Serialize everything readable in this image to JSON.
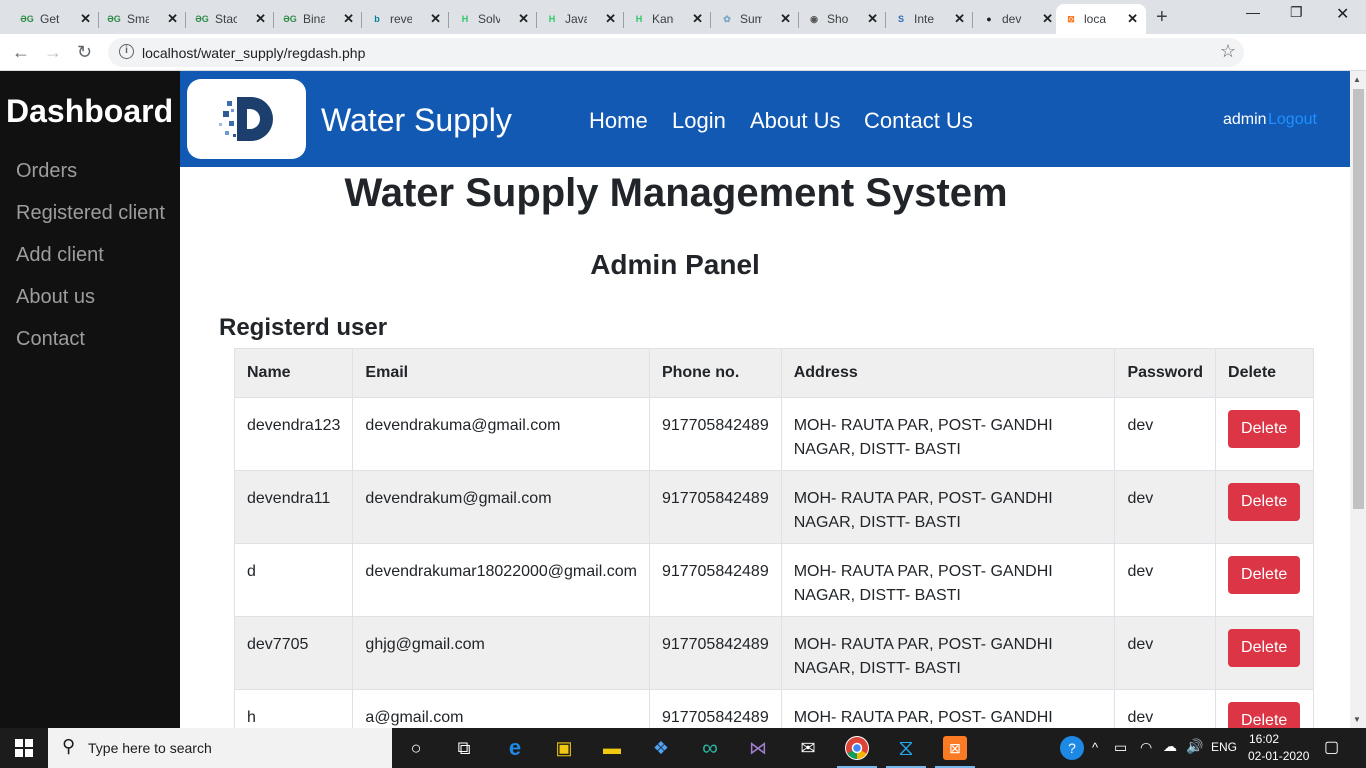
{
  "browser": {
    "tabs": [
      {
        "label": "Get",
        "icon": "geeksforgeeks-icon",
        "fav": "ƏG",
        "color": "#2f8d46"
      },
      {
        "label": "Sma",
        "icon": "geeksforgeeks-icon",
        "fav": "ƏG",
        "color": "#2f8d46"
      },
      {
        "label": "Stac",
        "icon": "geeksforgeeks-icon",
        "fav": "ƏG",
        "color": "#2f8d46"
      },
      {
        "label": "Bina",
        "icon": "geeksforgeeks-icon",
        "fav": "ƏG",
        "color": "#2f8d46"
      },
      {
        "label": "reve",
        "icon": "bing-icon",
        "fav": "b",
        "color": "#00809d"
      },
      {
        "label": "Solv",
        "icon": "hackerrank-icon",
        "fav": "H",
        "color": "#2ec866"
      },
      {
        "label": "Java",
        "icon": "hackerrank-icon",
        "fav": "H",
        "color": "#2ec866"
      },
      {
        "label": "Kang",
        "icon": "hackerrank-icon",
        "fav": "H",
        "color": "#2ec866"
      },
      {
        "label": "Sum",
        "icon": "tree-icon",
        "fav": "✿",
        "color": "#7aa7c7"
      },
      {
        "label": "Shor",
        "icon": "globe-icon",
        "fav": "◉",
        "color": "#555555"
      },
      {
        "label": "Inte",
        "icon": "interviewbit-icon",
        "fav": "S",
        "color": "#2a6ebb"
      },
      {
        "label": "dev",
        "icon": "github-icon",
        "fav": "●",
        "color": "#202124"
      },
      {
        "label": "loca",
        "icon": "xampp-icon",
        "fav": "⊠",
        "color": "#fb7a24"
      }
    ],
    "url": "localhost/water_supply/regdash.php"
  },
  "sidebar": {
    "brand": "Dashboard",
    "items": [
      "Orders",
      "Registered client",
      "Add client",
      "About us",
      "Contact"
    ]
  },
  "navbar": {
    "site_title": "Water Supply",
    "links": [
      "Home",
      "Login",
      "About Us",
      "Contact Us"
    ],
    "admin_name": "admin",
    "logout_label": "Logout"
  },
  "main": {
    "title": "Water Supply Management System",
    "panel_title": "Admin Panel",
    "section_title": "Registerd user"
  },
  "table": {
    "headers": [
      "Name",
      "Email",
      "Phone no.",
      "Address",
      "Password",
      "Delete"
    ],
    "rows": [
      {
        "name": "devendra123",
        "email": "devendrakuma@gmail.com",
        "phone": "917705842489",
        "address": "MOH- RAUTA PAR, POST- GANDHI NAGAR, DISTT- BASTI",
        "password": "dev",
        "action": "Delete"
      },
      {
        "name": "devendra11",
        "email": "devendrakum@gmail.com",
        "phone": "917705842489",
        "address": "MOH- RAUTA PAR, POST- GANDHI NAGAR, DISTT- BASTI",
        "password": "dev",
        "action": "Delete"
      },
      {
        "name": "d",
        "email": "devendrakumar18022000@gmail.com",
        "phone": "917705842489",
        "address": "MOH- RAUTA PAR, POST- GANDHI NAGAR, DISTT- BASTI",
        "password": "dev",
        "action": "Delete"
      },
      {
        "name": "dev7705",
        "email": "ghjg@gmail.com",
        "phone": "917705842489",
        "address": "MOH- RAUTA PAR, POST- GANDHI NAGAR, DISTT- BASTI",
        "password": "dev",
        "action": "Delete"
      },
      {
        "name": "h",
        "email": "a@gmail.com",
        "phone": "917705842489",
        "address": "MOH- RAUTA PAR, POST- GANDHI NAGAR, DISTT- BASTI",
        "password": "dev",
        "action": "Delete"
      }
    ]
  },
  "taskbar": {
    "search_placeholder": "Type here to search",
    "language": "ENG",
    "time": "16:02",
    "date": "02-01-2020"
  },
  "colors": {
    "navbar": "#1259b3",
    "sidebar": "#111111",
    "danger": "#dc3545",
    "logout": "#1e90ff"
  }
}
